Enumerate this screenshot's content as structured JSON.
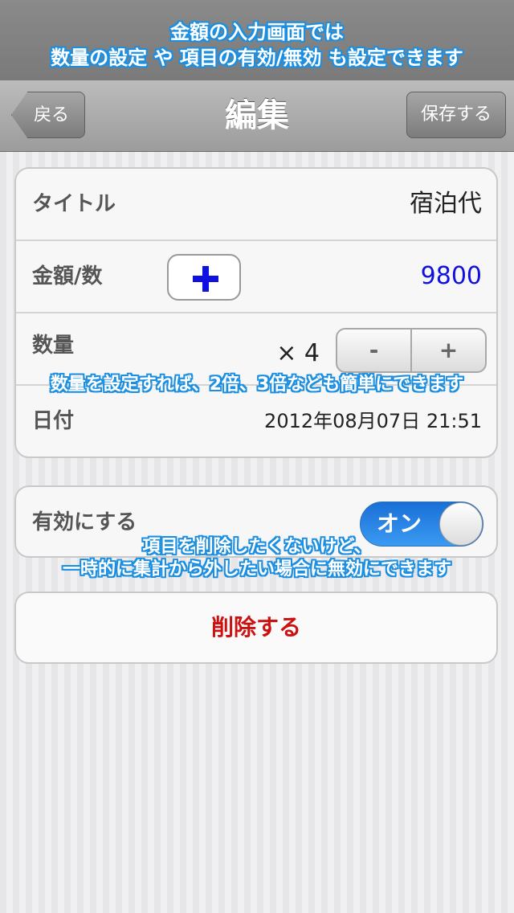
{
  "banner": {
    "line1": "金額の入力画面では",
    "line2": "数量の設定 や 項目の有効/無効 も設定できます"
  },
  "navbar": {
    "title": "編集",
    "back_label": "戻る",
    "save_label": "保存する"
  },
  "form": {
    "title_label": "タイトル",
    "title_value": "宿泊代",
    "amount_label": "金額/数",
    "amount_value": "9800",
    "quantity_label": "数量",
    "quantity_value": "× 4",
    "stepper_minus": "-",
    "stepper_plus": "+",
    "date_label": "日付",
    "date_value": "2012年08月07日 21:51"
  },
  "enable": {
    "label": "有効にする",
    "toggle_text": "オン",
    "state": "on"
  },
  "delete_label": "削除する",
  "annotations": {
    "quantity_note": "数量を設定すれば、2倍、3倍なども簡単にできます",
    "enable_note_1": "項目を削除したくないけど、",
    "enable_note_2": "一時的に集計から外したい場合に無効にできます"
  },
  "colors": {
    "amount": "#1010e0",
    "delete": "#cc1111",
    "toggle_on": "#1a6fd6",
    "caption_outline": "#1d8fe0"
  }
}
